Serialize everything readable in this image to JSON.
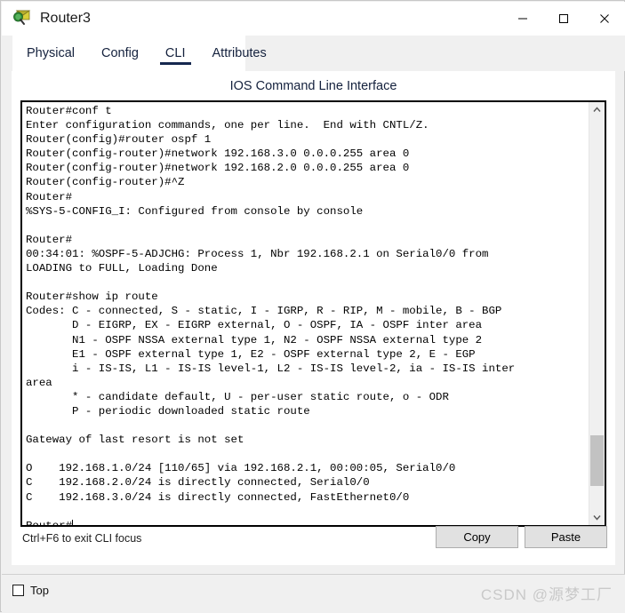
{
  "window": {
    "title": "Router3",
    "icon": "packet-tracer-device-icon",
    "controls": {
      "minimize": "—",
      "maximize": "☐",
      "close": "✕"
    }
  },
  "tabs": [
    {
      "label": "Physical",
      "active": false
    },
    {
      "label": "Config",
      "active": false
    },
    {
      "label": "CLI",
      "active": true
    },
    {
      "label": "Attributes",
      "active": false
    }
  ],
  "panel": {
    "title": "IOS Command Line Interface"
  },
  "terminal": {
    "lines": [
      "Router#conf t",
      "Enter configuration commands, one per line.  End with CNTL/Z.",
      "Router(config)#router ospf 1",
      "Router(config-router)#network 192.168.3.0 0.0.0.255 area 0",
      "Router(config-router)#network 192.168.2.0 0.0.0.255 area 0",
      "Router(config-router)#^Z",
      "Router#",
      "%SYS-5-CONFIG_I: Configured from console by console",
      "",
      "Router#",
      "00:34:01: %OSPF-5-ADJCHG: Process 1, Nbr 192.168.2.1 on Serial0/0 from",
      "LOADING to FULL, Loading Done",
      "",
      "Router#show ip route",
      "Codes: C - connected, S - static, I - IGRP, R - RIP, M - mobile, B - BGP",
      "       D - EIGRP, EX - EIGRP external, O - OSPF, IA - OSPF inter area",
      "       N1 - OSPF NSSA external type 1, N2 - OSPF NSSA external type 2",
      "       E1 - OSPF external type 1, E2 - OSPF external type 2, E - EGP",
      "       i - IS-IS, L1 - IS-IS level-1, L2 - IS-IS level-2, ia - IS-IS inter",
      "area",
      "       * - candidate default, U - per-user static route, o - ODR",
      "       P - periodic downloaded static route",
      "",
      "Gateway of last resort is not set",
      "",
      "O    192.168.1.0/24 [110/65] via 192.168.2.1, 00:00:05, Serial0/0",
      "C    192.168.2.0/24 is directly connected, Serial0/0",
      "C    192.168.3.0/24 is directly connected, FastEthernet0/0",
      "",
      "Router#"
    ],
    "prompt_cursor": true
  },
  "scrollbar": {
    "up_arrow": "⌃",
    "down_arrow": "⌄",
    "thumb_top_pct": 81,
    "thumb_height_pct": 13
  },
  "bottom": {
    "hint": "Ctrl+F6 to exit CLI focus",
    "copy_label": "Copy",
    "paste_label": "Paste"
  },
  "footer": {
    "top_checkbox_label": "Top",
    "top_checkbox_checked": false,
    "watermark": "CSDN @源梦工厂"
  },
  "colors": {
    "accent": "#16284f",
    "window_bg": "#f0f0f0",
    "panel_bg": "#ffffff",
    "terminal_fg": "#000000",
    "button_bg": "#e1e1e1",
    "watermark": "#c9c9c9"
  }
}
